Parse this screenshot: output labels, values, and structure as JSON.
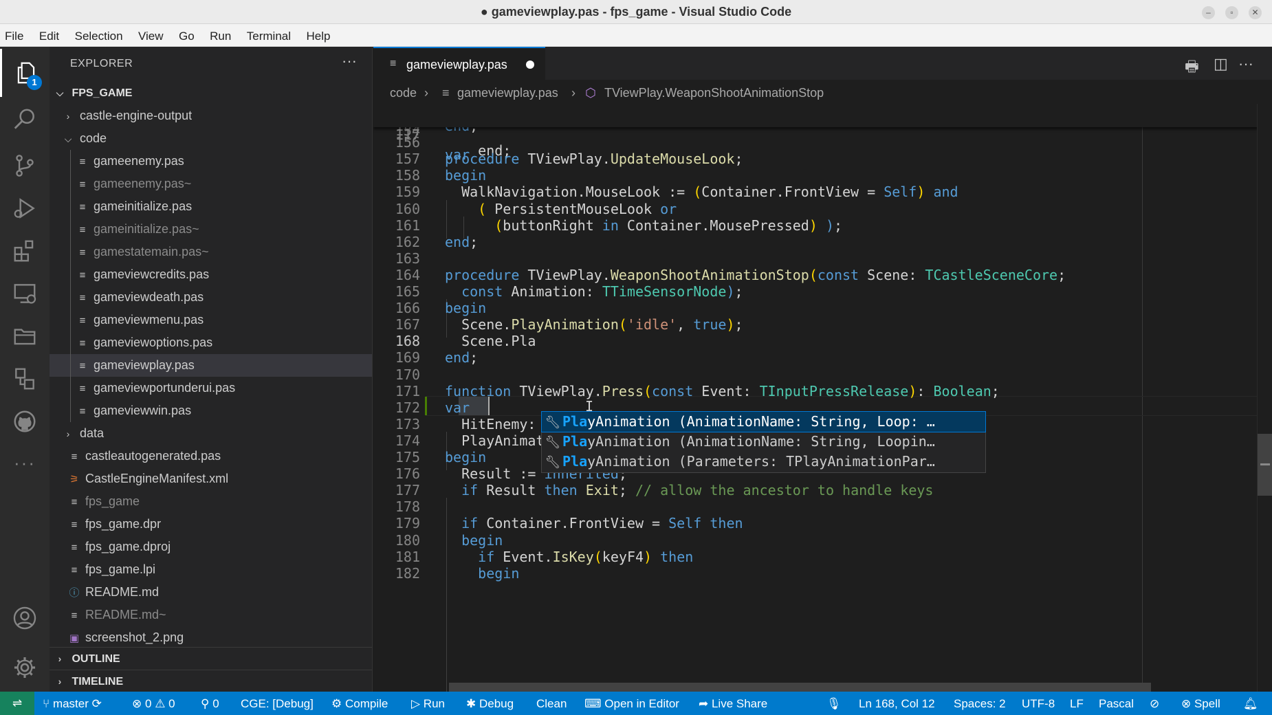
{
  "window": {
    "title": "● gameviewplay.pas - fps_game - Visual Studio Code"
  },
  "menu": [
    "File",
    "Edit",
    "Selection",
    "View",
    "Go",
    "Run",
    "Terminal",
    "Help"
  ],
  "activity": {
    "explorer_badge": "1"
  },
  "sidebar": {
    "title": "EXPLORER",
    "root": "FPS_GAME",
    "items": [
      {
        "label": "castle-engine-output",
        "kind": "folder-collapsed"
      },
      {
        "label": "code",
        "kind": "folder-open"
      },
      {
        "label": "gameenemy.pas",
        "kind": "file"
      },
      {
        "label": "gameenemy.pas~",
        "kind": "file-dim"
      },
      {
        "label": "gameinitialize.pas",
        "kind": "file"
      },
      {
        "label": "gameinitialize.pas~",
        "kind": "file-dim"
      },
      {
        "label": "gamestatemain.pas~",
        "kind": "file-dim"
      },
      {
        "label": "gameviewcredits.pas",
        "kind": "file"
      },
      {
        "label": "gameviewdeath.pas",
        "kind": "file"
      },
      {
        "label": "gameviewmenu.pas",
        "kind": "file"
      },
      {
        "label": "gameviewoptions.pas",
        "kind": "file"
      },
      {
        "label": "gameviewplay.pas",
        "kind": "file-selected"
      },
      {
        "label": "gameviewportunderui.pas",
        "kind": "file"
      },
      {
        "label": "gameviewwin.pas",
        "kind": "file"
      },
      {
        "label": "data",
        "kind": "folder-collapsed"
      },
      {
        "label": "castleautogenerated.pas",
        "kind": "file"
      },
      {
        "label": "CastleEngineManifest.xml",
        "kind": "file-xml"
      },
      {
        "label": "fps_game",
        "kind": "file-dim"
      },
      {
        "label": "fps_game.dpr",
        "kind": "file"
      },
      {
        "label": "fps_game.dproj",
        "kind": "file"
      },
      {
        "label": "fps_game.lpi",
        "kind": "file"
      },
      {
        "label": "README.md",
        "kind": "file-info"
      },
      {
        "label": "README.md~",
        "kind": "file-dim"
      },
      {
        "label": "screenshot_2.png",
        "kind": "file-image"
      }
    ],
    "outline": "OUTLINE",
    "timeline": "TIMELINE"
  },
  "editor": {
    "tab": "gameviewplay.pas",
    "breadcrumb": [
      "code",
      "gameviewplay.pas",
      "TViewPlay.WeaponShootAnimationStop"
    ],
    "sticky_line": {
      "num": "117",
      "text": "var"
    },
    "partial_line_text": "    end;",
    "current_line": "168",
    "lines": [
      {
        "num": "155",
        "text": "end;"
      },
      {
        "num": "156",
        "text": ""
      },
      {
        "num": "157",
        "text": "procedure TViewPlay.UpdateMouseLook;"
      },
      {
        "num": "158",
        "text": "begin"
      },
      {
        "num": "159",
        "text": "  WalkNavigation.MouseLook := (Container.FrontView = Self) and"
      },
      {
        "num": "160",
        "text": "    ( PersistentMouseLook or"
      },
      {
        "num": "161",
        "text": "      (buttonRight in Container.MousePressed) );"
      },
      {
        "num": "162",
        "text": "end;"
      },
      {
        "num": "163",
        "text": ""
      },
      {
        "num": "164",
        "text": "procedure TViewPlay.WeaponShootAnimationStop(const Scene: TCastleSceneCore;"
      },
      {
        "num": "165",
        "text": "  const Animation: TTimeSensorNode);"
      },
      {
        "num": "166",
        "text": "begin"
      },
      {
        "num": "167",
        "text": "  Scene.PlayAnimation('idle', true);"
      },
      {
        "num": "168",
        "text": "  Scene.Pla"
      },
      {
        "num": "169",
        "text": "end;"
      },
      {
        "num": "170",
        "text": ""
      },
      {
        "num": "171",
        "text": "function TViewPlay.Press(const Event: TInputPressRelease): Boolean;"
      },
      {
        "num": "172",
        "text": "var"
      },
      {
        "num": "173",
        "text": "  HitEnemy: TEnemy;"
      },
      {
        "num": "174",
        "text": "  PlayAnimationParams: TPlayAnimationParameters;"
      },
      {
        "num": "175",
        "text": "begin"
      },
      {
        "num": "176",
        "text": "  Result := inherited;"
      },
      {
        "num": "177",
        "text": "  if Result then Exit; // allow the ancestor to handle keys"
      },
      {
        "num": "178",
        "text": ""
      },
      {
        "num": "179",
        "text": "  if Container.FrontView = Self then"
      },
      {
        "num": "180",
        "text": "  begin"
      },
      {
        "num": "181",
        "text": "    if Event.IsKey(keyF4) then"
      },
      {
        "num": "182",
        "text": "    begin"
      }
    ],
    "suggestions": [
      {
        "match": "Pla",
        "rest": "yAnimation (AnimationName: String, Loop: …"
      },
      {
        "match": "Pla",
        "rest": "yAnimation (AnimationName: String, Loopin…"
      },
      {
        "match": "Pla",
        "rest": "yAnimation (Parameters: TPlayAnimationPar…"
      }
    ]
  },
  "statusbar": {
    "branch": "master",
    "errors": "0",
    "warnings": "0",
    "ports": "0",
    "cge": "CGE: [Debug]",
    "compile": "Compile",
    "run": "Run",
    "debug": "Debug",
    "clean": "Clean",
    "open_in_editor": "Open in Editor",
    "live_share": "Live Share",
    "position": "Ln 168, Col 12",
    "spaces": "Spaces: 2",
    "encoding": "UTF-8",
    "eol": "LF",
    "language": "Pascal",
    "spell": "Spell"
  },
  "colors": {
    "accent": "#007acc",
    "keyword": "#569cd6",
    "type": "#4ec9b0",
    "function": "#dcdcaa",
    "string": "#ce9178",
    "comment": "#6a9955"
  }
}
